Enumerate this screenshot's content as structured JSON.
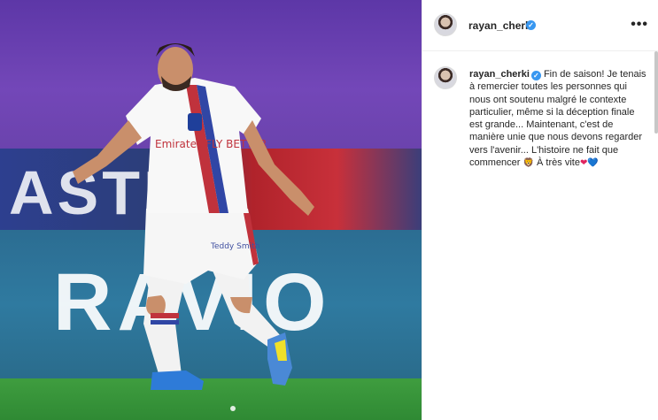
{
  "photo": {
    "board_text": "ASTRO",
    "ad_text": "RAVIO",
    "shirt_text": "Emirates FLY BETTER",
    "shorts_text": "Teddy Smith"
  },
  "header": {
    "username": "rayan_cherki",
    "verified_mark": "✓",
    "more_label": "•••"
  },
  "caption": {
    "username": "rayan_cherki",
    "verified_mark": "✓",
    "text": "Fin de saison! Je tenais à remercier toutes les personnes qui nous ont soutenu malgré le contexte particulier, même si la déception finale est grande... Maintenant, c'est de manière unie que nous devons regarder vers l'avenir... L'histoire ne fait que commencer",
    "emoji_lion": "🦁",
    "text_end": " À très vite",
    "emoji_red_heart": "❤",
    "emoji_blue_heart": "💙"
  },
  "colors": {
    "verified": "#3897f0",
    "text": "#262626",
    "border": "#efefef"
  }
}
